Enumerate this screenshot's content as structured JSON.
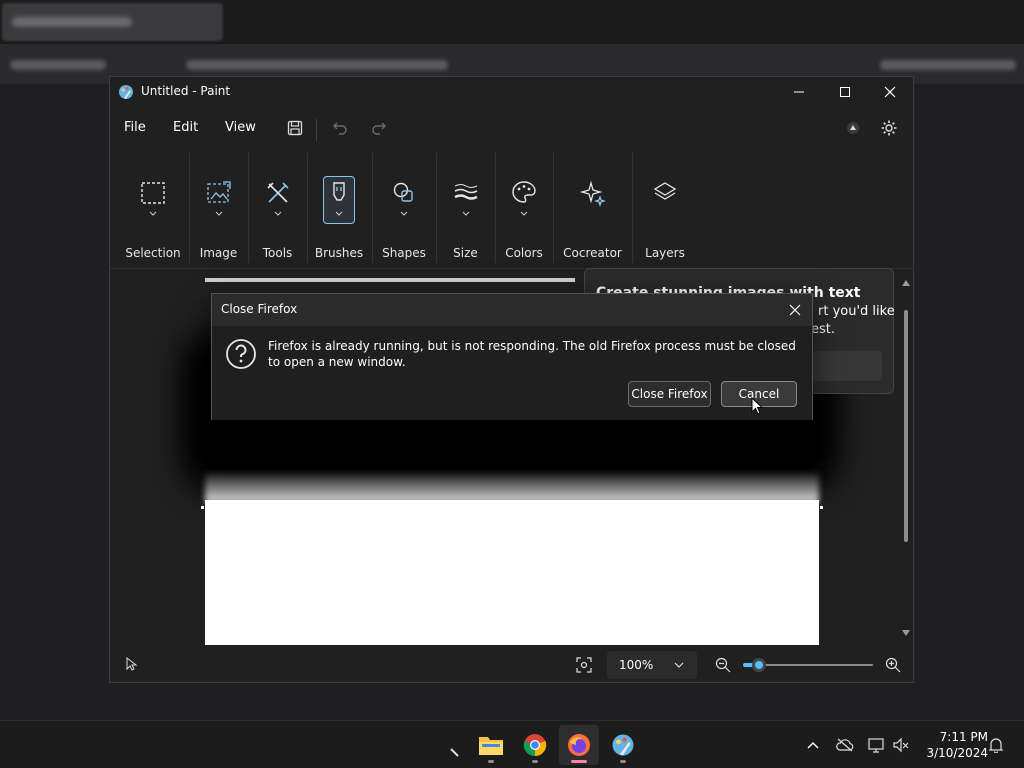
{
  "window": {
    "title": "Untitled - Paint",
    "controls": {
      "minimize": "–",
      "maximize": "☐",
      "close": "✕"
    }
  },
  "menu": {
    "file": "File",
    "edit": "Edit",
    "view": "View"
  },
  "ribbon": {
    "selection": "Selection",
    "image": "Image",
    "tools": "Tools",
    "brushes": "Brushes",
    "shapes": "Shapes",
    "size": "Size",
    "colors": "Colors",
    "cocreator": "Cocreator",
    "layers": "Layers"
  },
  "tooltip": {
    "title": "Create stunning images with text",
    "fragment1": "rt you'd like",
    "fragment2": "est."
  },
  "dialog": {
    "title": "Close Firefox",
    "message": "Firefox is already running, but is not responding. The old Firefox process must be closed to open a new window.",
    "close_button": "Close Firefox",
    "cancel_button": "Cancel"
  },
  "statusbar": {
    "zoom": "100%",
    "zoom_level": 0.12
  },
  "taskbar": {
    "time": "7:11 PM",
    "date": "3/10/2024"
  },
  "colors": {
    "accent": "#8fc4ea",
    "slider": "#4cc2ff",
    "firefox_underline": "#f08aa0"
  }
}
